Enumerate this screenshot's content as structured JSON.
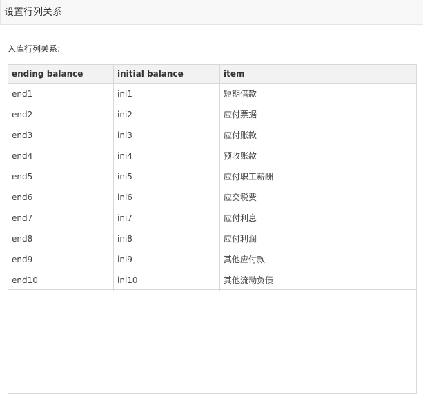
{
  "dialog": {
    "title": "设置行列关系"
  },
  "section_label": "入库行列关系:",
  "table": {
    "columns": [
      "ending balance",
      "initial balance",
      "item"
    ],
    "rows": [
      [
        "end1",
        "ini1",
        "短期借款"
      ],
      [
        "end2",
        "ini2",
        "应付票据"
      ],
      [
        "end3",
        "ini3",
        "应付账款"
      ],
      [
        "end4",
        "ini4",
        "预收账款"
      ],
      [
        "end5",
        "ini5",
        "应付职工薪酬"
      ],
      [
        "end6",
        "ini6",
        "应交税费"
      ],
      [
        "end7",
        "ini7",
        "应付利息"
      ],
      [
        "end8",
        "ini8",
        "应付利润"
      ],
      [
        "end9",
        "ini9",
        "其他应付款"
      ],
      [
        "end10",
        "ini10",
        "其他流动负债"
      ]
    ]
  }
}
